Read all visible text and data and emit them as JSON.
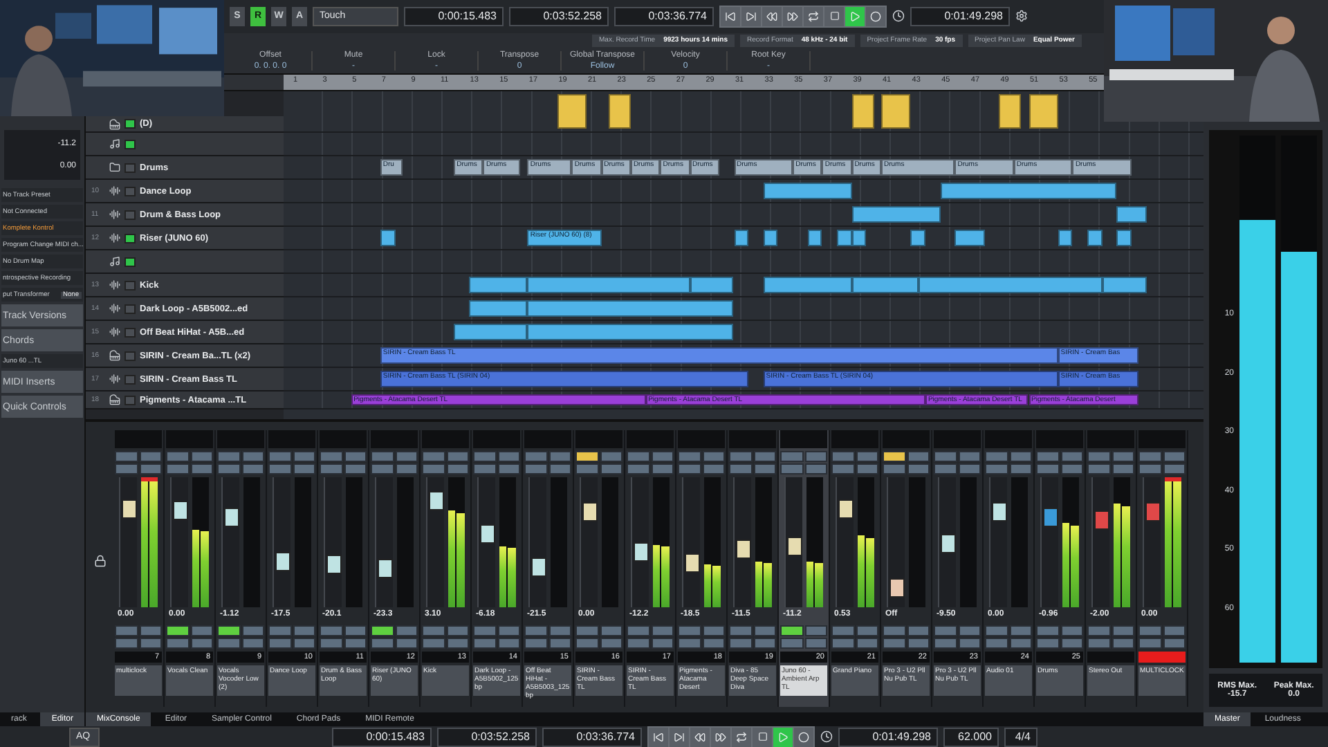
{
  "toolbar": {
    "modes": [
      {
        "label": "S",
        "on": false
      },
      {
        "label": "R",
        "on": true
      },
      {
        "label": "W",
        "on": false
      },
      {
        "label": "A",
        "on": false
      }
    ],
    "automation_mode": "Touch",
    "left_locator": "0:00:15.483",
    "right_locator": "0:03:52.258",
    "length": "0:03:36.774",
    "playing": true,
    "time": "0:01:49.298"
  },
  "status": [
    {
      "label": "Max. Record Time",
      "value": "9923 hours 14 mins"
    },
    {
      "label": "Record Format",
      "value": "48 kHz - 24 bit"
    },
    {
      "label": "Project Frame Rate",
      "value": "30 fps"
    },
    {
      "label": "Project Pan Law",
      "value": "Equal Power"
    }
  ],
  "info_line": [
    {
      "label": "Offset",
      "value": "0. 0. 0. 0"
    },
    {
      "label": "Mute",
      "value": "-"
    },
    {
      "label": "Lock",
      "value": "-"
    },
    {
      "label": "Transpose",
      "value": "0"
    },
    {
      "label": "Global Transpose",
      "value": "Follow"
    },
    {
      "label": "Velocity",
      "value": "0"
    },
    {
      "label": "Root Key",
      "value": "-"
    }
  ],
  "inspector": {
    "volume": "-11.2",
    "delay": "0.00",
    "rows": [
      {
        "kind": "field",
        "label": "No Track Preset"
      },
      {
        "kind": "field",
        "label": "Not Connected"
      },
      {
        "kind": "accent",
        "label": "Komplete Kontrol"
      },
      {
        "kind": "field",
        "label": "Program Change MIDI ch..."
      },
      {
        "kind": "field",
        "label": "No Drum Map"
      },
      {
        "kind": "field",
        "label": "ntrospective Recording"
      },
      {
        "kind": "select",
        "label": "put Transformer",
        "value": "None"
      },
      {
        "kind": "section",
        "label": "Track Versions"
      },
      {
        "kind": "section",
        "label": "Chords"
      },
      {
        "kind": "field",
        "label": "Juno 60 ...TL"
      },
      {
        "kind": "section",
        "label": "MIDI Inserts"
      },
      {
        "kind": "section",
        "label": "Quick Controls"
      }
    ]
  },
  "ruler": [
    "1",
    "3",
    "5",
    "7",
    "9",
    "11",
    "13",
    "15",
    "17",
    "19",
    "21",
    "23",
    "25",
    "27",
    "29",
    "31",
    "33",
    "35",
    "37",
    "39",
    "41",
    "43",
    "45",
    "47",
    "49",
    "51",
    "53",
    "55"
  ],
  "tracks": [
    {
      "kind": "instrument",
      "name": "(D)",
      "monitor": true,
      "color": "#e8c34a"
    },
    {
      "kind": "midi",
      "monitor": true
    },
    {
      "kind": "folder",
      "name": "Drums",
      "monitor": false,
      "color": "#9fb0bf",
      "clip_labels": [
        "Dru",
        "Drums",
        "Drums",
        "Drums",
        "Drums",
        "Drums",
        "Drums",
        "Drums",
        "Drums",
        "Drums",
        "Drums",
        "Drums",
        "Drums",
        "Drums",
        "Drums",
        "Drums",
        "Drums"
      ]
    },
    {
      "kind": "audio",
      "number": "10",
      "name": "Dance Loop",
      "monitor": false,
      "color": "#4fb3e8"
    },
    {
      "kind": "audio",
      "number": "11",
      "name": "Drum & Bass Loop",
      "monitor": false,
      "color": "#4fb3e8"
    },
    {
      "kind": "audio",
      "number": "12",
      "name": "Riser (JUNO 60)",
      "monitor": true,
      "color": "#4fb3e8",
      "clip_labels": [
        "Riser (JUNO 60) (8)"
      ]
    },
    {
      "kind": "midi",
      "monitor": true
    },
    {
      "kind": "audio",
      "number": "13",
      "name": "Kick",
      "monitor": false,
      "color": "#4fb3e8"
    },
    {
      "kind": "audio",
      "number": "14",
      "name": "Dark Loop - A5B5002...ed",
      "monitor": false,
      "color": "#4fb3e8"
    },
    {
      "kind": "audio",
      "number": "15",
      "name": "Off Beat HiHat - A5B...ed",
      "monitor": false,
      "color": "#4fb3e8"
    },
    {
      "kind": "instrument",
      "number": "16",
      "name": "SIRIN - Cream Ba...TL (x2)",
      "monitor": false,
      "color": "#5b86e8",
      "clip_labels": [
        "SIRIN - Cream Bass TL",
        "SIRIN - Cream Bas"
      ]
    },
    {
      "kind": "audio",
      "number": "17",
      "name": "SIRIN - Cream Bass TL",
      "monitor": false,
      "color": "#4a72d8",
      "clip_labels": [
        "SIRIN - Cream Bass TL (SIRIN 04)",
        "SIRIN - Cream Bass TL (SIRIN 04)",
        "SIRIN - Cream Bas"
      ]
    },
    {
      "kind": "instrument",
      "number": "18",
      "name": "Pigments - Atacama ...TL",
      "monitor": false,
      "color": "#9a3fd8",
      "clip_labels": [
        "Pigments - Atacama Desert TL",
        "Pigments - Atacama Desert TL",
        "Pigments - Atacama Desert TL",
        "Pigments - Atacama Desert"
      ]
    }
  ],
  "mixer": {
    "channels": [
      {
        "name": "multiclock",
        "number": "7",
        "value": "0.00",
        "color": "#e6dcb0",
        "fader": {
          "level": 0.8
        },
        "meter": {
          "level": 1
        },
        "clipped": true,
        "muted": false,
        "monitor": false,
        "selected": false,
        "armed": false
      },
      {
        "name": "Vocals Clean",
        "number": "8",
        "value": "0.00",
        "color": "#bfe3e3",
        "fader": {
          "level": 0.79
        },
        "meter": {
          "level": 0.6
        },
        "clipped": false,
        "muted": false,
        "monitor": true,
        "selected": false,
        "armed": false
      },
      {
        "name": "Vocals Vocoder Low (2)",
        "number": "9",
        "value": "-1.12",
        "color": "#bfe3e3",
        "fader": {
          "level": 0.73
        },
        "meter": {
          "level": 0
        },
        "clipped": false,
        "muted": false,
        "monitor": true,
        "selected": false,
        "armed": false
      },
      {
        "name": "Dance Loop",
        "number": "10",
        "value": "-17.5",
        "color": "#bfe3e3",
        "fader": {
          "level": 0.33
        },
        "meter": {
          "level": 0
        },
        "clipped": false,
        "muted": false,
        "monitor": false,
        "selected": false,
        "armed": false
      },
      {
        "name": "Drum & Bass Loop",
        "number": "11",
        "value": "-20.1",
        "color": "#bfe3e3",
        "fader": {
          "level": 0.3
        },
        "meter": {
          "level": 0
        },
        "clipped": false,
        "muted": false,
        "monitor": false,
        "selected": false,
        "armed": false
      },
      {
        "name": "Riser (JUNO 60)",
        "number": "12",
        "value": "-23.3",
        "color": "#bfe3e3",
        "fader": {
          "level": 0.26
        },
        "meter": {
          "level": 0
        },
        "clipped": false,
        "muted": false,
        "monitor": true,
        "selected": false,
        "armed": false
      },
      {
        "name": "Kick",
        "number": "13",
        "value": "3.10",
        "color": "#bfe3e3",
        "fader": {
          "level": 0.87
        },
        "meter": {
          "level": 0.75
        },
        "clipped": false,
        "muted": false,
        "monitor": false,
        "selected": false,
        "armed": false
      },
      {
        "name": "Dark Loop - A5B5002_125bp",
        "number": "14",
        "value": "-6.18",
        "color": "#bfe3e3",
        "fader": {
          "level": 0.58
        },
        "meter": {
          "level": 0.47
        },
        "clipped": false,
        "muted": false,
        "monitor": false,
        "selected": false,
        "armed": false
      },
      {
        "name": "Off Beat HiHat - A5B5003_125bp",
        "number": "15",
        "value": "-21.5",
        "color": "#bfe3e3",
        "fader": {
          "level": 0.28
        },
        "meter": {
          "level": 0
        },
        "clipped": false,
        "muted": false,
        "monitor": false,
        "selected": false,
        "armed": false
      },
      {
        "name": "SIRIN - Cream Bass TL",
        "number": "16",
        "value": "0.00",
        "color": "#e6dcb0",
        "fader": {
          "level": 0.77
        },
        "meter": {
          "level": 0
        },
        "clipped": false,
        "muted": true,
        "monitor": false,
        "selected": false,
        "armed": false
      },
      {
        "name": "SIRIN - Cream Bass TL",
        "number": "17",
        "value": "-12.2",
        "color": "#bfe3e3",
        "fader": {
          "level": 0.41
        },
        "meter": {
          "level": 0.48
        },
        "clipped": false,
        "muted": false,
        "monitor": false,
        "selected": false,
        "armed": false
      },
      {
        "name": "Pigments - Atacama Desert",
        "number": "18",
        "value": "-18.5",
        "color": "#e6dcb0",
        "fader": {
          "level": 0.31
        },
        "meter": {
          "level": 0.33
        },
        "clipped": false,
        "muted": false,
        "monitor": false,
        "selected": false,
        "armed": false
      },
      {
        "name": "Diva - 85 Deep Space Diva",
        "number": "19",
        "value": "-11.5",
        "color": "#e6dcb0",
        "fader": {
          "level": 0.44
        },
        "meter": {
          "level": 0.35
        },
        "clipped": false,
        "muted": false,
        "monitor": false,
        "selected": false,
        "armed": false
      },
      {
        "name": "Juno 60 - Ambient Arp TL",
        "number": "20",
        "value": "-11.2",
        "color": "#e6dcb0",
        "fader": {
          "level": 0.46
        },
        "meter": {
          "level": 0.35
        },
        "clipped": false,
        "muted": false,
        "monitor": true,
        "selected": true,
        "armed": false
      },
      {
        "name": "Grand Piano",
        "number": "21",
        "value": "0.53",
        "color": "#e6dcb0",
        "fader": {
          "level": 0.8
        },
        "meter": {
          "level": 0.55
        },
        "clipped": false,
        "muted": false,
        "monitor": false,
        "selected": false,
        "armed": false
      },
      {
        "name": "Pro 3 - U2 Pll Nu Pub TL",
        "number": "22",
        "value": "Off",
        "color": "#e8c8b0",
        "fader": {
          "level": 0.09
        },
        "meter": {
          "level": 0
        },
        "clipped": false,
        "muted": true,
        "monitor": false,
        "selected": false,
        "armed": false
      },
      {
        "name": "Pro 3 - U2 Pll Nu Pub TL",
        "number": "23",
        "value": "-9.50",
        "color": "#bfe3e3",
        "fader": {
          "level": 0.49
        },
        "meter": {
          "level": 0
        },
        "clipped": false,
        "muted": false,
        "monitor": false,
        "selected": false,
        "armed": false
      },
      {
        "name": "Audio 01",
        "number": "24",
        "value": "0.00",
        "color": "#bfe3e3",
        "fader": {
          "level": 0.78
        },
        "meter": {
          "level": 0
        },
        "clipped": false,
        "muted": false,
        "monitor": false,
        "selected": false,
        "armed": false
      },
      {
        "name": "Drums",
        "number": "25",
        "value": "-0.96",
        "color": "#3a9ad8",
        "fader": {
          "level": 0.73
        },
        "meter": {
          "level": 0.65
        },
        "clipped": false,
        "muted": false,
        "monitor": false,
        "selected": false,
        "armed": false
      },
      {
        "name": "Stereo Out",
        "value": "-2.00",
        "color": "#e04848",
        "fader": {
          "level": 0.7
        },
        "meter": {
          "level": 0.8
        },
        "clipped": false,
        "muted": false,
        "monitor": false,
        "selected": false,
        "armed": false
      },
      {
        "name": "MULTICLOCK",
        "value": "0.00",
        "color": "#e04848",
        "fader": {
          "level": 0.78
        },
        "meter": {
          "level": 1
        },
        "clipped": true,
        "muted": false,
        "monitor": false,
        "selected": false,
        "armed": true
      }
    ]
  },
  "master": {
    "meters": [
      {
        "level": 0.84
      },
      {
        "level": 0.78
      }
    ],
    "scale": [
      "10",
      "20",
      "30",
      "40",
      "50",
      "60"
    ],
    "stats": [
      {
        "label": "RMS Max.",
        "value": "-15.7"
      },
      {
        "label": "Peak Max.",
        "value": "0.0"
      }
    ]
  },
  "tabs": {
    "left": [
      {
        "label": "rack",
        "selected": false
      },
      {
        "label": "Editor",
        "selected": true
      }
    ],
    "main": [
      {
        "label": "MixConsole",
        "selected": true
      },
      {
        "label": "Editor",
        "selected": false
      },
      {
        "label": "Sampler Control",
        "selected": false
      },
      {
        "label": "Chord Pads",
        "selected": false
      },
      {
        "label": "MIDI Remote",
        "selected": false
      }
    ],
    "right": [
      {
        "label": "Master",
        "selected": true
      },
      {
        "label": "Loudness",
        "selected": false
      }
    ]
  },
  "transport": {
    "quantize": "AQ",
    "left_locator": "0:00:15.483",
    "right_locator": "0:03:52.258",
    "length": "0:03:36.774",
    "playing": true,
    "time": "0:01:49.298",
    "tempo": "62.000",
    "signature": "4/4"
  }
}
